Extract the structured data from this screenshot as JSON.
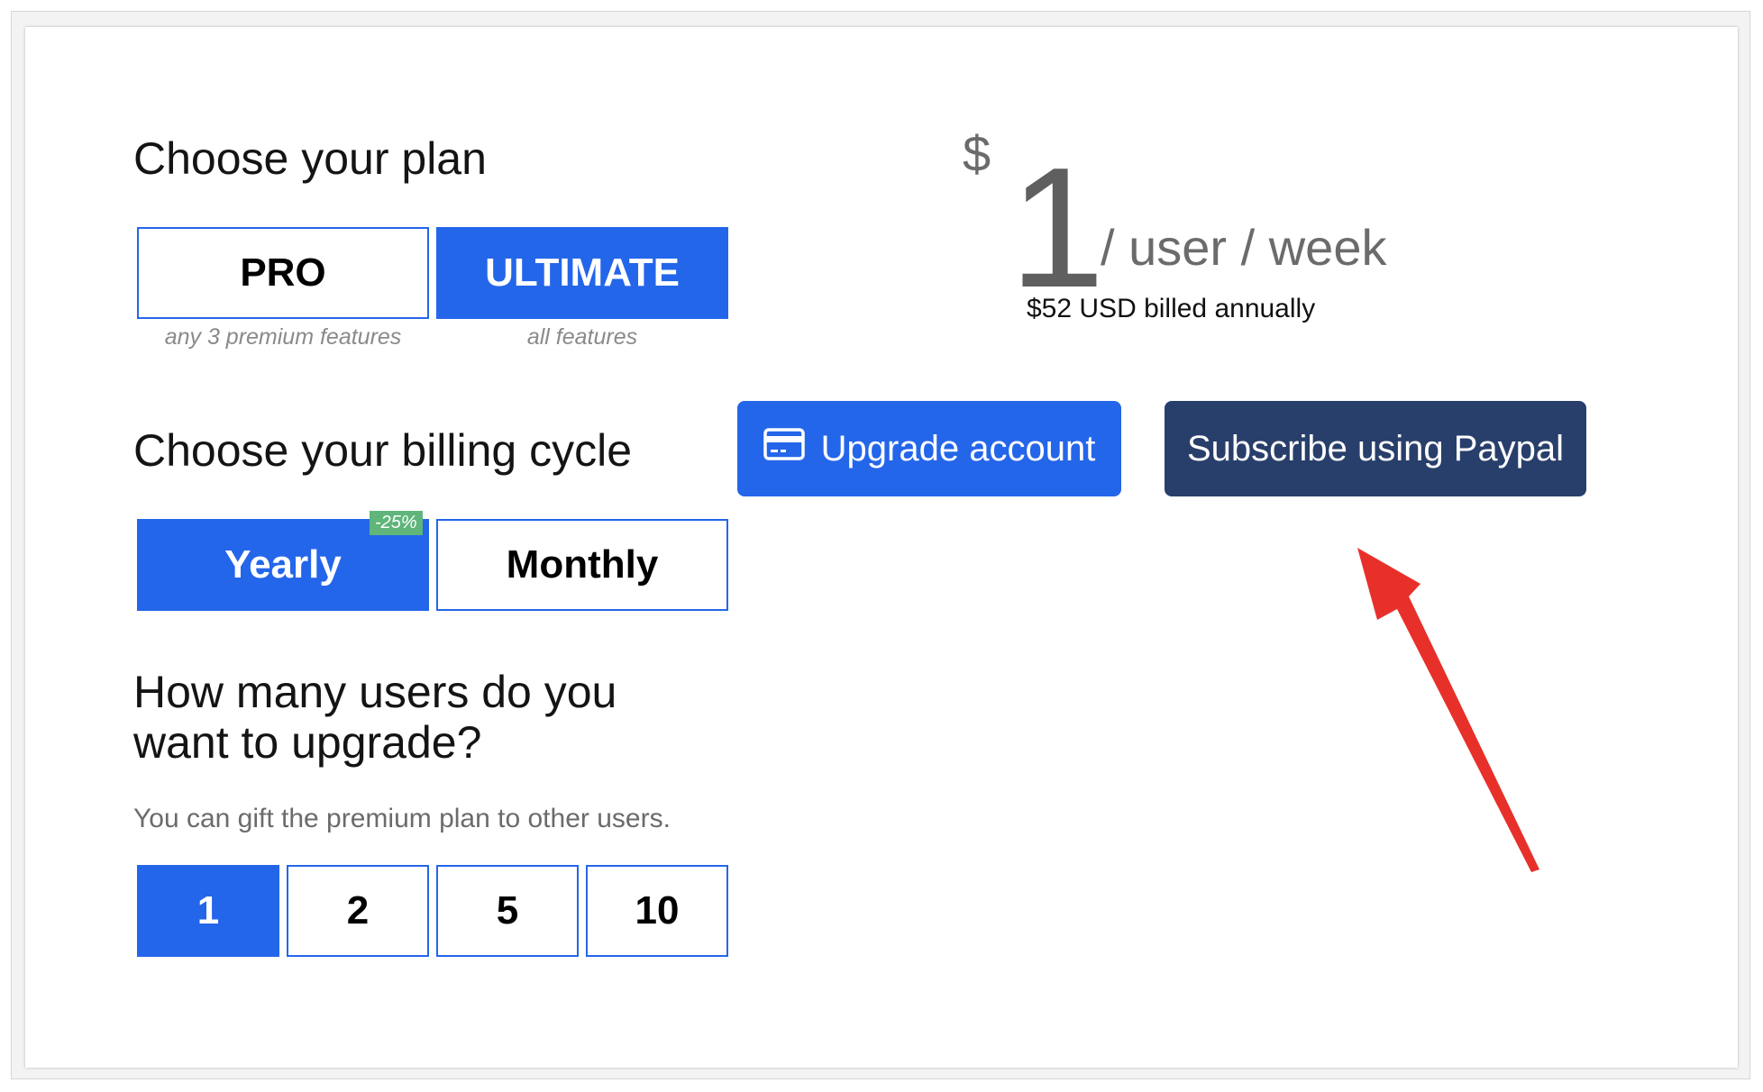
{
  "plan": {
    "heading": "Choose your plan",
    "options": [
      {
        "label": "PRO",
        "sub": "any 3 premium features",
        "selected": false
      },
      {
        "label": "ULTIMATE",
        "sub": "all features",
        "selected": true
      }
    ]
  },
  "billing": {
    "heading": "Choose your billing cycle",
    "options": [
      {
        "label": "Yearly",
        "badge": "-25%",
        "selected": true
      },
      {
        "label": "Monthly",
        "selected": false
      }
    ]
  },
  "users": {
    "heading_line1": "How many users do you",
    "heading_line2": "want to upgrade?",
    "note": "You can gift the premium plan to other users.",
    "options": [
      {
        "label": "1",
        "selected": true
      },
      {
        "label": "2",
        "selected": false
      },
      {
        "label": "5",
        "selected": false
      },
      {
        "label": "10",
        "selected": false
      }
    ]
  },
  "price": {
    "currency": "$",
    "amount": "1",
    "unit": "/ user / week",
    "billed": "$52 USD billed annually"
  },
  "actions": {
    "upgrade_label": "Upgrade account",
    "upgrade_icon": "credit-card-icon",
    "paypal_label": "Subscribe using Paypal"
  },
  "colors": {
    "accent": "#2466ea",
    "paypal": "#283f6b",
    "badge": "#5fb57a",
    "annotation_arrow": "#e8302a"
  }
}
